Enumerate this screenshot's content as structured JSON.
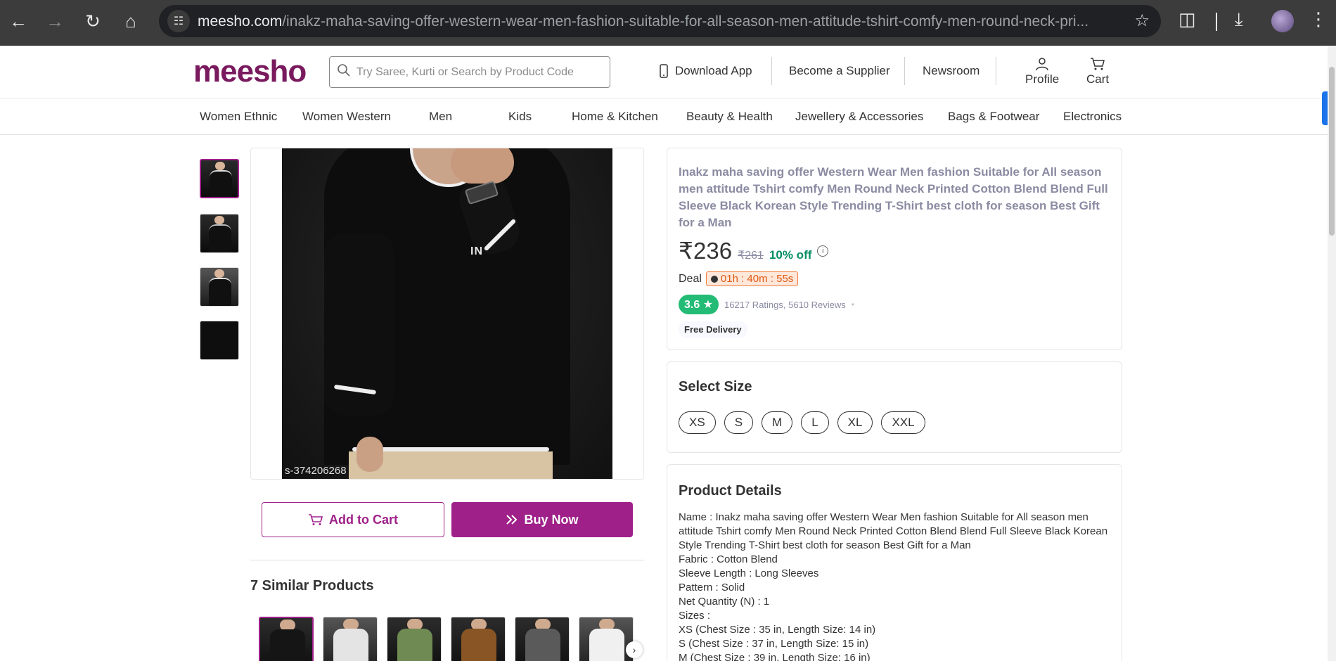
{
  "browser": {
    "url_host": "meesho.com",
    "url_path": "/inakz-maha-saving-offer-western-wear-men-fashion-suitable-for-all-season-men-attitude-tshirt-comfy-men-round-neck-pri..."
  },
  "header": {
    "logo": "meesho",
    "search_placeholder": "Try Saree, Kurti or Search by Product Code",
    "download_app": "Download App",
    "become_supplier": "Become a Supplier",
    "newsroom": "Newsroom",
    "profile": "Profile",
    "cart": "Cart"
  },
  "categories": [
    "Women Ethnic",
    "Women Western",
    "Men",
    "Kids",
    "Home & Kitchen",
    "Beauty & Health",
    "Jewellery & Accessories",
    "Bags & Footwear",
    "Electronics"
  ],
  "gallery": {
    "product_code": "s-374206268",
    "brand_mark": "IN"
  },
  "actions": {
    "add_to_cart": "Add to Cart",
    "buy_now": "Buy Now"
  },
  "similar": {
    "title": "7 Similar Products",
    "colors": [
      "#151515",
      "#e4e4e4",
      "#6f8a52",
      "#8a5524",
      "#5a5a5a",
      "#f0f0f0"
    ]
  },
  "product": {
    "title": "Inakz maha saving offer Western Wear Men fashion Suitable for All season men attitude Tshirt comfy Men Round Neck Printed Cotton Blend Blend Full Sleeve Black Korean Style Trending T-Shirt best cloth for season Best Gift for a Man",
    "price": "₹236",
    "mrp": "₹261",
    "discount": "10% off",
    "deal_label": "Deal",
    "deal_timer": "01h : 40m : 55s",
    "rating": "3.6",
    "rating_text": "16217 Ratings, 5610 Reviews",
    "free_delivery": "Free Delivery"
  },
  "sizes": {
    "title": "Select Size",
    "options": [
      "XS",
      "S",
      "M",
      "L",
      "XL",
      "XXL"
    ]
  },
  "details": {
    "title": "Product Details",
    "lines": [
      "Name : Inakz maha saving offer Western Wear Men fashion Suitable for All season men attitude Tshirt comfy Men Round Neck Printed Cotton Blend Blend Full Sleeve Black Korean Style Trending T-Shirt best cloth for season Best Gift for a Man",
      "Fabric : Cotton Blend",
      "Sleeve Length : Long Sleeves",
      "Pattern : Solid",
      "Net Quantity (N) : 1",
      "Sizes :",
      "XS (Chest Size : 35 in, Length Size: 14 in)",
      "S (Chest Size : 37 in, Length Size: 15 in)",
      "M (Chest Size : 39 in, Length Size: 16 in)"
    ]
  }
}
